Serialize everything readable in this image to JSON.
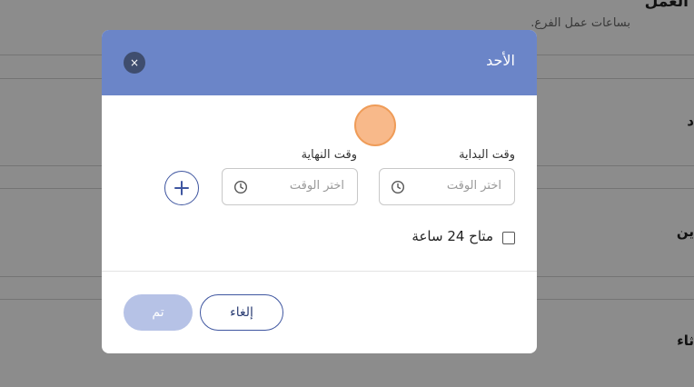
{
  "background": {
    "title": "العمل",
    "subtitle": "بساعات عمل الفرع.",
    "rows": [
      {
        "label": "د"
      },
      {
        "label": "ين"
      },
      {
        "label": "ثاء"
      }
    ]
  },
  "dialog": {
    "title": "الأحد",
    "close_label": "×",
    "start_label": "وقت البداية",
    "start_placeholder": "اختر الوقت",
    "end_label": "وقت النهاية",
    "end_placeholder": "اختر الوقت",
    "all_day_label": "متاح 24 ساعة",
    "all_day_checked": false,
    "cancel_label": "إلغاء",
    "done_label": "تم"
  },
  "colors": {
    "header": "#6b85c8",
    "primary": "#3f56a0",
    "done_disabled": "#b6c2e6",
    "cursor": "#f8b98a"
  },
  "icons": [
    "close-icon",
    "clock-icon",
    "plus-icon"
  ]
}
